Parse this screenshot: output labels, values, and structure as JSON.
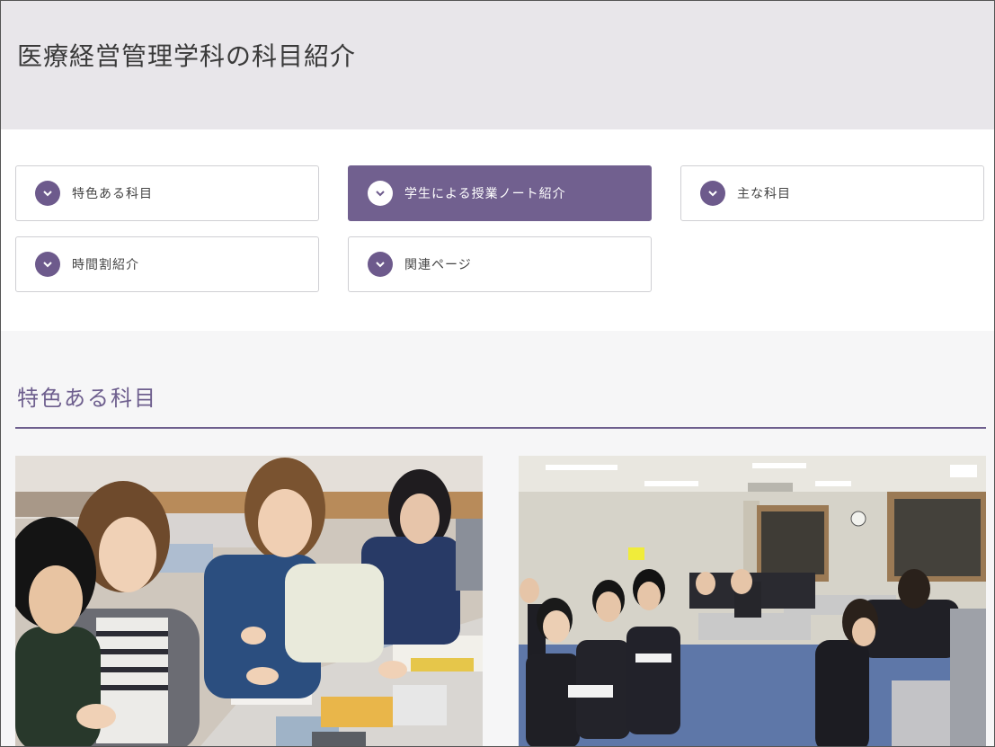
{
  "page": {
    "title": "医療経営管理学科の科目紹介"
  },
  "nav": {
    "items": [
      {
        "label": "特色ある科目",
        "icon": "chevron-down-icon",
        "active": false
      },
      {
        "label": "学生による授業ノート紹介",
        "icon": "chevron-down-icon",
        "active": true
      },
      {
        "label": "主な科目",
        "icon": "chevron-down-icon",
        "active": false
      },
      {
        "label": "時間割紹介",
        "icon": "chevron-down-icon",
        "active": false
      },
      {
        "label": "関連ページ",
        "icon": "chevron-down-icon",
        "active": false
      }
    ]
  },
  "section": {
    "title": "特色ある科目"
  },
  "colors": {
    "accent": "#6e5f8e",
    "active_button": "#71608f",
    "header_bg": "#e8e6ea",
    "section_bg": "#f6f6f7"
  }
}
